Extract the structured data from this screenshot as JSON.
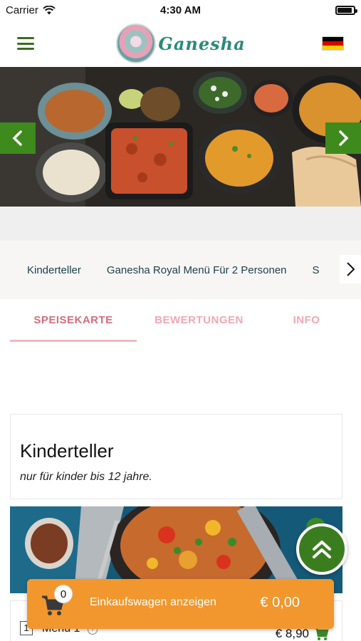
{
  "status_bar": {
    "carrier": "Carrier",
    "time": "4:30 AM",
    "battery_level": 0.9
  },
  "header": {
    "logo_text": "Ganesha",
    "language": "german-flag",
    "flag_colors": [
      "#000000",
      "#dd0000",
      "#ffce00"
    ]
  },
  "hero": {
    "prev_icon": "chevron-left-icon",
    "next_icon": "chevron-right-icon"
  },
  "categories": {
    "items": [
      "Kinderteller",
      "Ganesha Royal Menü Für 2 Personen",
      "S"
    ]
  },
  "tabs": {
    "items": [
      "SPEISEKARTE",
      "BEWERTUNGEN",
      "INFO"
    ],
    "active": "SPEISEKARTE"
  },
  "section": {
    "title": "Kinderteller",
    "subtitle": "nur für kinder bis 12 jahre."
  },
  "item": {
    "qty": "1",
    "name": "Menü 1",
    "price": "€ 8,90"
  },
  "cart": {
    "count": "0",
    "label": "Einkaufswagen anzeigen",
    "total": "€ 0,00"
  },
  "colors": {
    "brand_green": "#3e8a1c",
    "accent_pink": "#d86b7c",
    "cart_orange": "#f2972d"
  }
}
